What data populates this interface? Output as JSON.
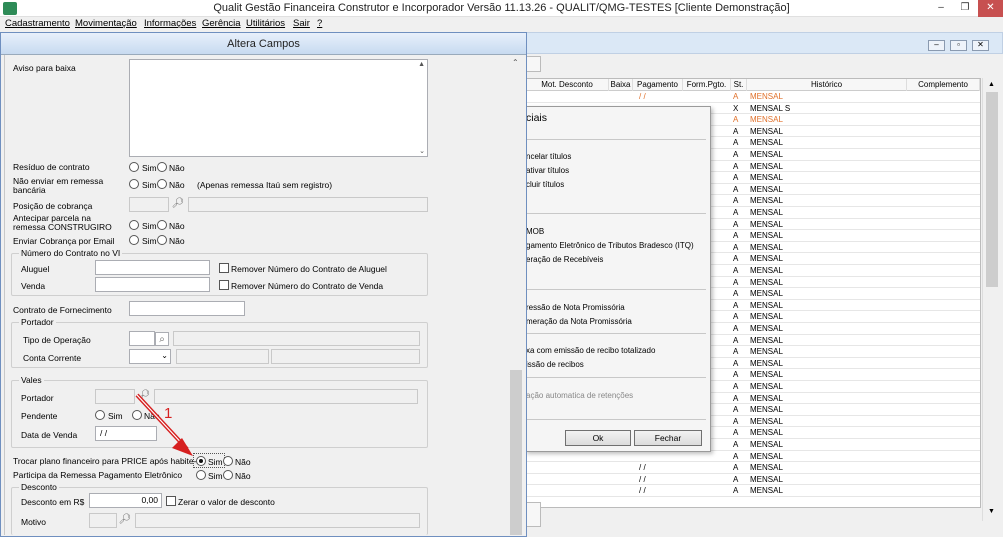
{
  "app": {
    "title": "Qualit Gestão Financeira Construtor e Incorporador Versão 11.13.26 - QUALIT/QMG-TESTES [Cliente Demonstração]",
    "window_buttons": {
      "minimize": "‒",
      "restore": "❐",
      "close": "✕"
    }
  },
  "menu": [
    "Cadastramento",
    "Movimentação",
    "Informações",
    "Gerência",
    "Utilitários",
    "Sair",
    "?"
  ],
  "grid": {
    "columns": [
      "Mot. Desconto",
      "Baixa",
      "Pagamento",
      "Form.Pgto.",
      "St.",
      "Histórico",
      "Complemento"
    ],
    "rows": [
      {
        "pag": "/  /",
        "st": "A",
        "hist": "MENSAL",
        "orange": true
      },
      {
        "pag": "",
        "st": "X",
        "hist": "MENSAL S",
        "orange": false
      },
      {
        "pag": "",
        "st": "A",
        "hist": "MENSAL",
        "orange": true
      },
      {
        "pag": "",
        "st": "A",
        "hist": "MENSAL",
        "orange": false
      },
      {
        "pag": "",
        "st": "A",
        "hist": "MENSAL",
        "orange": false
      },
      {
        "pag": "",
        "st": "A",
        "hist": "MENSAL",
        "orange": false
      },
      {
        "pag": "",
        "st": "A",
        "hist": "MENSAL",
        "orange": false
      },
      {
        "pag": "",
        "st": "A",
        "hist": "MENSAL",
        "orange": false
      },
      {
        "pag": "",
        "st": "A",
        "hist": "MENSAL",
        "orange": false
      },
      {
        "pag": "",
        "st": "A",
        "hist": "MENSAL",
        "orange": false
      },
      {
        "pag": "",
        "st": "A",
        "hist": "MENSAL",
        "orange": false
      },
      {
        "pag": "",
        "st": "A",
        "hist": "MENSAL",
        "orange": false
      },
      {
        "pag": "",
        "st": "A",
        "hist": "MENSAL",
        "orange": false
      },
      {
        "pag": "",
        "st": "A",
        "hist": "MENSAL",
        "orange": false
      },
      {
        "pag": "",
        "st": "A",
        "hist": "MENSAL",
        "orange": false
      },
      {
        "pag": "",
        "st": "A",
        "hist": "MENSAL",
        "orange": false
      },
      {
        "pag": "",
        "st": "A",
        "hist": "MENSAL",
        "orange": false
      },
      {
        "pag": "",
        "st": "A",
        "hist": "MENSAL",
        "orange": false
      },
      {
        "pag": "",
        "st": "A",
        "hist": "MENSAL",
        "orange": false
      },
      {
        "pag": "",
        "st": "A",
        "hist": "MENSAL",
        "orange": false
      },
      {
        "pag": "",
        "st": "A",
        "hist": "MENSAL",
        "orange": false
      },
      {
        "pag": "",
        "st": "A",
        "hist": "MENSAL",
        "orange": false
      },
      {
        "pag": "",
        "st": "A",
        "hist": "MENSAL",
        "orange": false
      },
      {
        "pag": "",
        "st": "A",
        "hist": "MENSAL",
        "orange": false
      },
      {
        "pag": "",
        "st": "A",
        "hist": "MENSAL",
        "orange": false
      },
      {
        "pag": "",
        "st": "A",
        "hist": "MENSAL",
        "orange": false
      },
      {
        "pag": "",
        "st": "A",
        "hist": "MENSAL",
        "orange": false
      },
      {
        "pag": "",
        "st": "A",
        "hist": "MENSAL",
        "orange": false
      },
      {
        "pag": "",
        "st": "A",
        "hist": "MENSAL",
        "orange": false
      },
      {
        "pag": "",
        "st": "A",
        "hist": "MENSAL",
        "orange": false
      },
      {
        "pag": "",
        "st": "A",
        "hist": "MENSAL",
        "orange": false
      },
      {
        "pag": "",
        "st": "A",
        "hist": "MENSAL",
        "orange": false
      },
      {
        "pag": "/  /",
        "st": "A",
        "hist": "MENSAL",
        "orange": false
      },
      {
        "pag": "/  /",
        "st": "A",
        "hist": "MENSAL",
        "orange": false
      },
      {
        "pag": "/  /",
        "st": "A",
        "hist": "MENSAL",
        "orange": false
      }
    ]
  },
  "popup": {
    "title": "ciais",
    "items": [
      "ncelar títulos",
      "ativar títulos",
      "cluir títulos",
      "MOB",
      "gamento Eletrônico de Tributos Bradesco (ITQ)",
      "eração de Recebíveis",
      "ressão de Nota Promissória",
      "meração da Nota Promissória",
      "xa com emissão de recibo totalizado",
      "issão de recibos",
      "ação automatica de retenções"
    ],
    "ok": "Ok",
    "close": "Fechar"
  },
  "dialog": {
    "title": "Altera Campos",
    "aviso_label": "Aviso para baixa",
    "residuo_label": "Resíduo de contrato",
    "nao_enviar_label": "Não enviar em remessa bancária",
    "nao_enviar_note": "(Apenas remessa Itaú sem registro)",
    "posicao_label": "Posição de cobrança",
    "antecipar_label": "Antecipar parcela na remessa CONSTRUGIRO",
    "enviar_email_label": "Enviar Cobrança por Email",
    "sim": "Sim",
    "nao": "Não",
    "numero_contrato_group": "Número do Contrato no VI",
    "aluguel_label": "Aluguel",
    "venda_label": "Venda",
    "remover_aluguel": "Remover Número do Contrato de Aluguel",
    "remover_venda": "Remover Número do Contrato de Venda",
    "contrato_fornecimento_label": "Contrato de Fornecimento",
    "portador_group": "Portador",
    "tipo_operacao_label": "Tipo de Operação",
    "conta_corrente_label": "Conta Corrente",
    "vales_group": "Vales",
    "vales_portador_label": "Portador",
    "pendente_label": "Pendente",
    "data_venda_label": "Data de Venda",
    "data_venda_value": " /  /",
    "trocar_plano_label": "Trocar plano financeiro para PRICE após habite-se",
    "participa_label": "Participa da Remessa Pagamento Eletrônico",
    "desconto_group": "Desconto",
    "desconto_rs_label": "Desconto em R$",
    "desconto_value": "0,00",
    "zerar_label": "Zerar o valor de desconto",
    "motivo_label": "Motivo"
  },
  "annotation": {
    "number": "1",
    "color": "#e02020"
  }
}
